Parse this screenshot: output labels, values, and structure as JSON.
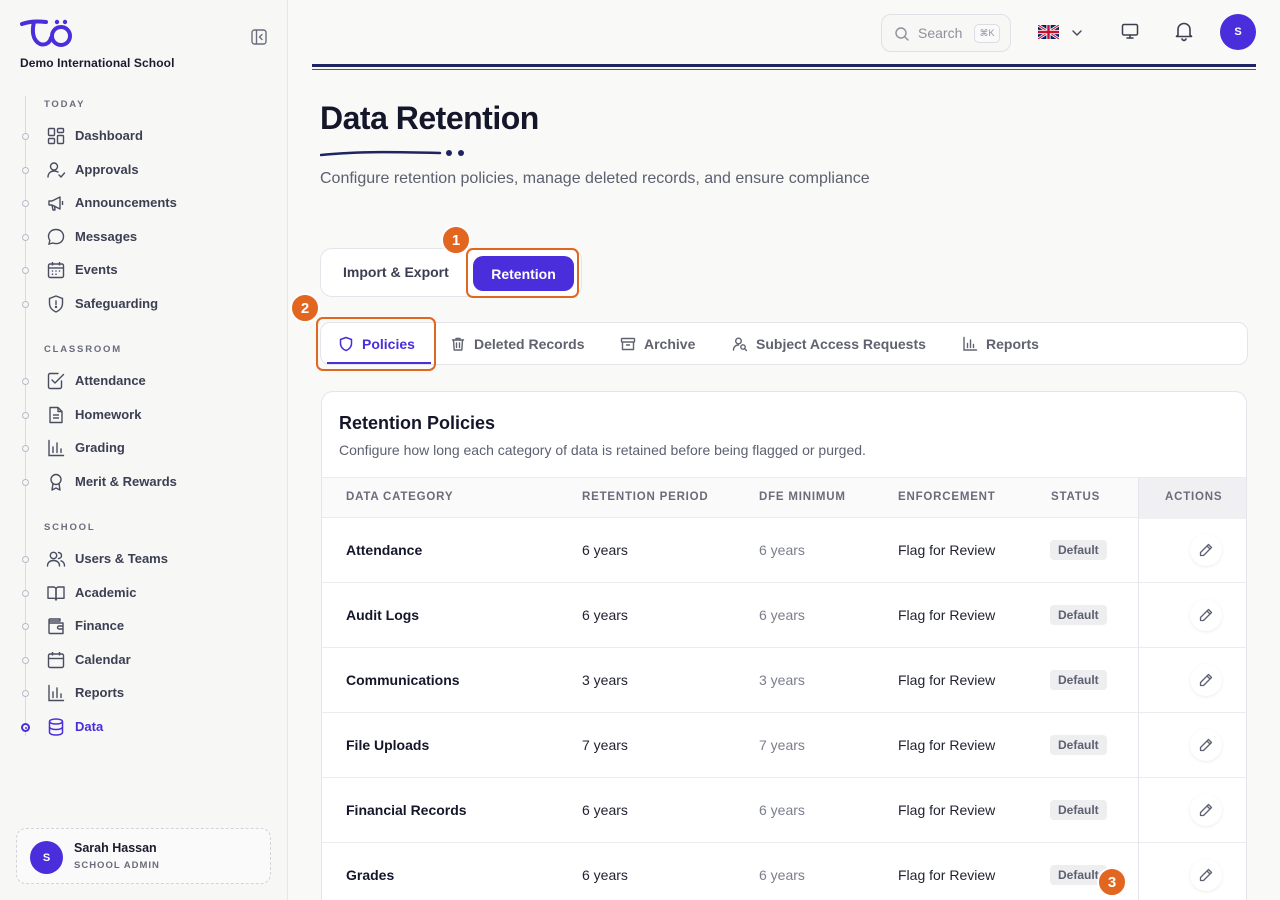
{
  "school": {
    "name": "Demo International School"
  },
  "sidebar": {
    "sections": [
      {
        "label": "TODAY"
      },
      {
        "label": "CLASSROOM"
      },
      {
        "label": "SCHOOL"
      }
    ],
    "items": [
      {
        "label": "Dashboard",
        "icon": "grid-icon"
      },
      {
        "label": "Approvals",
        "icon": "user-check-icon"
      },
      {
        "label": "Announcements",
        "icon": "megaphone-icon"
      },
      {
        "label": "Messages",
        "icon": "chat-bubble-icon"
      },
      {
        "label": "Events",
        "icon": "calendar-icon"
      },
      {
        "label": "Safeguarding",
        "icon": "shield-icon"
      },
      {
        "label": "Attendance",
        "icon": "checkbox-icon"
      },
      {
        "label": "Homework",
        "icon": "document-icon"
      },
      {
        "label": "Grading",
        "icon": "bar-chart-icon"
      },
      {
        "label": "Merit & Rewards",
        "icon": "award-icon"
      },
      {
        "label": "Users & Teams",
        "icon": "users-icon"
      },
      {
        "label": "Academic",
        "icon": "book-icon"
      },
      {
        "label": "Finance",
        "icon": "wallet-icon"
      },
      {
        "label": "Calendar",
        "icon": "calendar-icon"
      },
      {
        "label": "Reports",
        "icon": "bar-chart-icon"
      },
      {
        "label": "Data",
        "icon": "database-icon",
        "active": true
      }
    ],
    "user": {
      "initial": "S",
      "name": "Sarah Hassan",
      "role": "SCHOOL ADMIN"
    }
  },
  "topbar": {
    "search_placeholder": "Search",
    "search_shortcut": "⌘K",
    "language": "English (UK flag)",
    "avatar_initial": "S"
  },
  "header": {
    "title": "Data Retention",
    "subtitle": "Configure retention policies, manage deleted records, and ensure compliance"
  },
  "top_tabs": [
    {
      "label": "Import & Export"
    },
    {
      "label": "Retention",
      "active": true
    }
  ],
  "sub_tabs": [
    {
      "label": "Policies",
      "icon": "shield-icon",
      "active": true
    },
    {
      "label": "Deleted Records",
      "icon": "trash-icon"
    },
    {
      "label": "Archive",
      "icon": "archive-icon"
    },
    {
      "label": "Subject Access Requests",
      "icon": "user-search-icon"
    },
    {
      "label": "Reports",
      "icon": "bar-chart-icon"
    }
  ],
  "annotations": [
    "1",
    "2",
    "3"
  ],
  "card": {
    "title": "Retention Policies",
    "description": "Configure how long each category of data is retained before being flagged or purged.",
    "columns": [
      "DATA CATEGORY",
      "RETENTION PERIOD",
      "DFE MINIMUM",
      "ENFORCEMENT",
      "STATUS",
      "ACTIONS"
    ],
    "rows": [
      {
        "category": "Attendance",
        "retention": "6 years",
        "dfe_min": "6 years",
        "enforcement": "Flag for Review",
        "status": "Default"
      },
      {
        "category": "Audit Logs",
        "retention": "6 years",
        "dfe_min": "6 years",
        "enforcement": "Flag for Review",
        "status": "Default"
      },
      {
        "category": "Communications",
        "retention": "3 years",
        "dfe_min": "3 years",
        "enforcement": "Flag for Review",
        "status": "Default"
      },
      {
        "category": "File Uploads",
        "retention": "7 years",
        "dfe_min": "7 years",
        "enforcement": "Flag for Review",
        "status": "Default"
      },
      {
        "category": "Financial Records",
        "retention": "6 years",
        "dfe_min": "6 years",
        "enforcement": "Flag for Review",
        "status": "Default"
      },
      {
        "category": "Grades",
        "retention": "6 years",
        "dfe_min": "6 years",
        "enforcement": "Flag for Review",
        "status": "Default"
      }
    ]
  },
  "colors": {
    "accent": "#4a2ddb",
    "annotation": "#e2661f",
    "navy": "#1f2560"
  }
}
